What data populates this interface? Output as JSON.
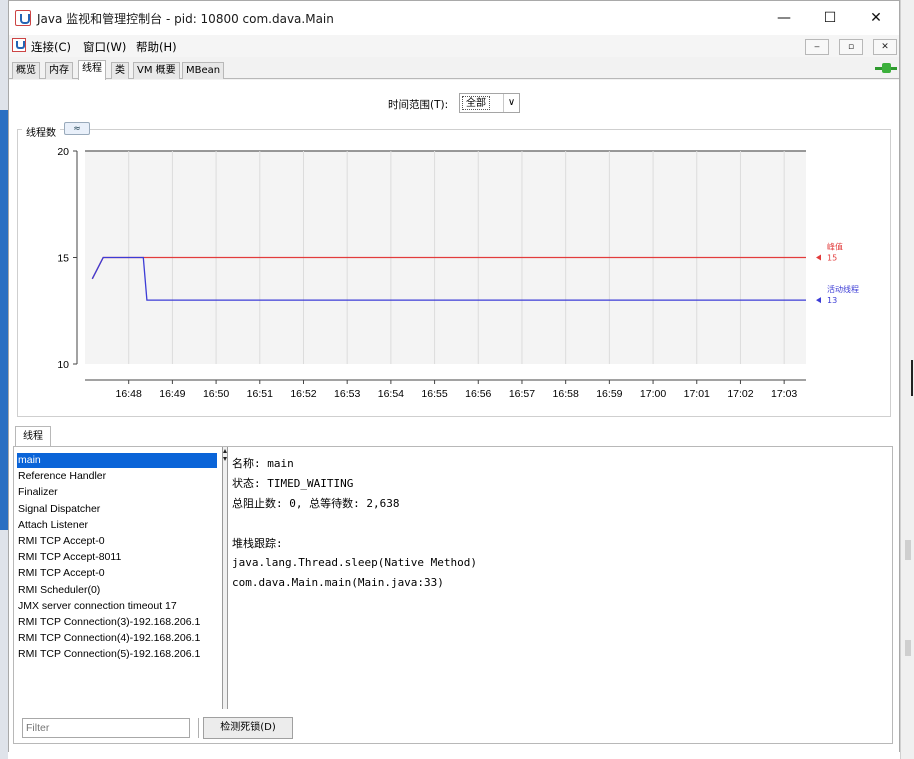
{
  "window": {
    "title": "Java 监视和管理控制台 - pid: 10800 com.dava.Main",
    "min_glyph": "—",
    "max_glyph": "☐",
    "close_glyph": "✕"
  },
  "menu": {
    "items": [
      "连接(C)",
      "窗口(W)",
      "帮助(H)"
    ],
    "mdi_buttons": [
      "‒",
      "▫",
      "✕"
    ]
  },
  "tabs": [
    "概览",
    "内存",
    "线程",
    "类",
    "VM 概要",
    "MBean"
  ],
  "active_tab": "线程",
  "time_range": {
    "label": "时间范围(T):",
    "value": "全部",
    "arrow": "∨"
  },
  "chart_panel": {
    "caption": "线程数",
    "collapse_glyph": "≈"
  },
  "chart_data": {
    "type": "line",
    "title": "线程数",
    "xlabel": "",
    "ylabel": "",
    "x": [
      "16:47:10",
      "16:47:25",
      "16:48:20",
      "16:48:25",
      "17:03:30"
    ],
    "xticks": [
      "16:48",
      "16:49",
      "16:50",
      "16:51",
      "16:52",
      "16:53",
      "16:54",
      "16:55",
      "16:56",
      "16:57",
      "16:58",
      "16:59",
      "17:00",
      "17:01",
      "17:02",
      "17:03"
    ],
    "yticks": [
      "10",
      "15",
      "20"
    ],
    "ylim": [
      10,
      20
    ],
    "series": [
      {
        "name": "峰值",
        "values": [
          14,
          15,
          15,
          15,
          15
        ],
        "last": "15",
        "color": "#e23c3c"
      },
      {
        "name": "活动线程",
        "values": [
          14,
          15,
          15,
          13,
          13
        ],
        "last": "13",
        "color": "#3c3cd6"
      }
    ],
    "grid": true,
    "legend": "right"
  },
  "threads": {
    "tab_label": "线程",
    "items": [
      "main",
      "Reference Handler",
      "Finalizer",
      "Signal Dispatcher",
      "Attach Listener",
      "RMI TCP Accept-0",
      "RMI TCP Accept-8011",
      "RMI TCP Accept-0",
      "RMI Scheduler(0)",
      "JMX server connection timeout 17",
      "RMI TCP Connection(3)-192.168.206.1",
      "RMI TCP Connection(4)-192.168.206.1",
      "RMI TCP Connection(5)-192.168.206.1"
    ],
    "selected": "main",
    "details": {
      "name": "名称: main",
      "state": "状态: TIMED_WAITING",
      "blocked": "总阻止数: 0, 总等待数: 2,638",
      "stack_title": "堆栈跟踪:",
      "stack": [
        "java.lang.Thread.sleep(Native Method)",
        "com.dava.Main.main(Main.java:33)"
      ]
    },
    "filter_placeholder": "Filter",
    "detect_button": "检测死锁(D)"
  }
}
